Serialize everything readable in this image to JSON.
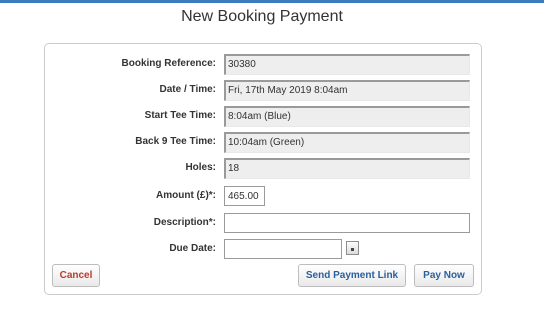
{
  "page": {
    "title": "New Booking Payment"
  },
  "form": {
    "booking_reference": {
      "label": "Booking Reference:",
      "value": "30380"
    },
    "date_time": {
      "label": "Date / Time:",
      "value": "Fri, 17th May 2019 8:04am"
    },
    "start_tee_time": {
      "label": "Start Tee Time:",
      "value": "8:04am (Blue)"
    },
    "back9_tee_time": {
      "label": "Back 9 Tee Time:",
      "value": "10:04am (Green)"
    },
    "holes": {
      "label": "Holes:",
      "value": "18"
    },
    "amount": {
      "label": "Amount (£)*:",
      "value": "465.00"
    },
    "description": {
      "label": "Description*:",
      "value": ""
    },
    "due_date": {
      "label": "Due Date:",
      "value": ""
    }
  },
  "buttons": {
    "cancel": "Cancel",
    "send_payment_link": "Send Payment Link",
    "pay_now": "Pay Now"
  },
  "icons": {
    "date_picker": "calendar-icon"
  },
  "colors": {
    "accent_rule": "#3c7bbf",
    "cancel_text": "#c0392b",
    "action_text": "#2a5f9c"
  }
}
